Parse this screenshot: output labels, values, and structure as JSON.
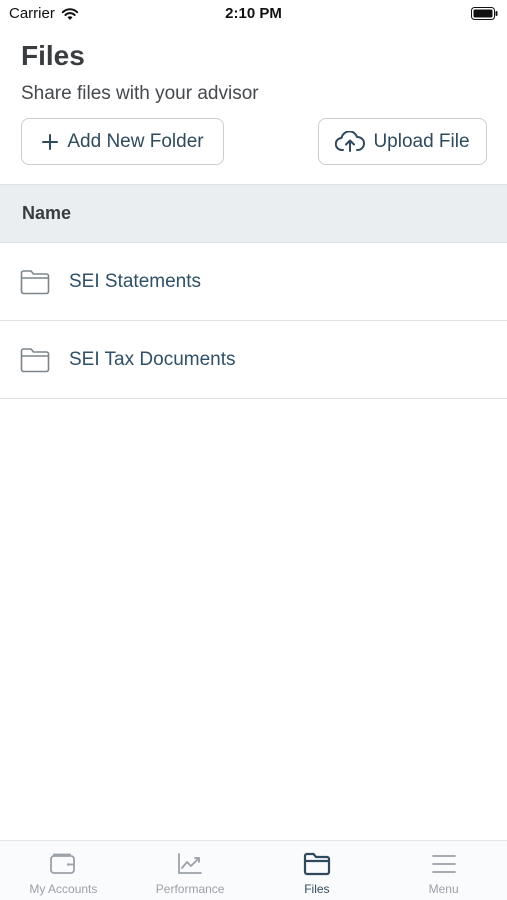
{
  "status_bar": {
    "carrier": "Carrier",
    "time": "2:10 PM"
  },
  "header": {
    "title": "Files",
    "subtitle": "Share files with your advisor"
  },
  "actions": {
    "add_folder_label": "Add New Folder",
    "upload_label": "Upload File"
  },
  "table": {
    "column_name": "Name",
    "rows": [
      {
        "icon": "folder-icon",
        "name": "SEI Statements"
      },
      {
        "icon": "folder-icon",
        "name": "SEI Tax Documents"
      }
    ]
  },
  "tab_bar": {
    "items": [
      {
        "icon": "wallet-icon",
        "label": "My Accounts",
        "active": false
      },
      {
        "icon": "chart-line-icon",
        "label": "Performance",
        "active": false
      },
      {
        "icon": "folder-icon",
        "label": "Files",
        "active": true
      },
      {
        "icon": "menu-icon",
        "label": "Menu",
        "active": false
      }
    ]
  },
  "colors": {
    "accent": "#2f4a5c",
    "inactive_tab": "#9aa1a8",
    "table_header_bg": "#ebeef1"
  }
}
